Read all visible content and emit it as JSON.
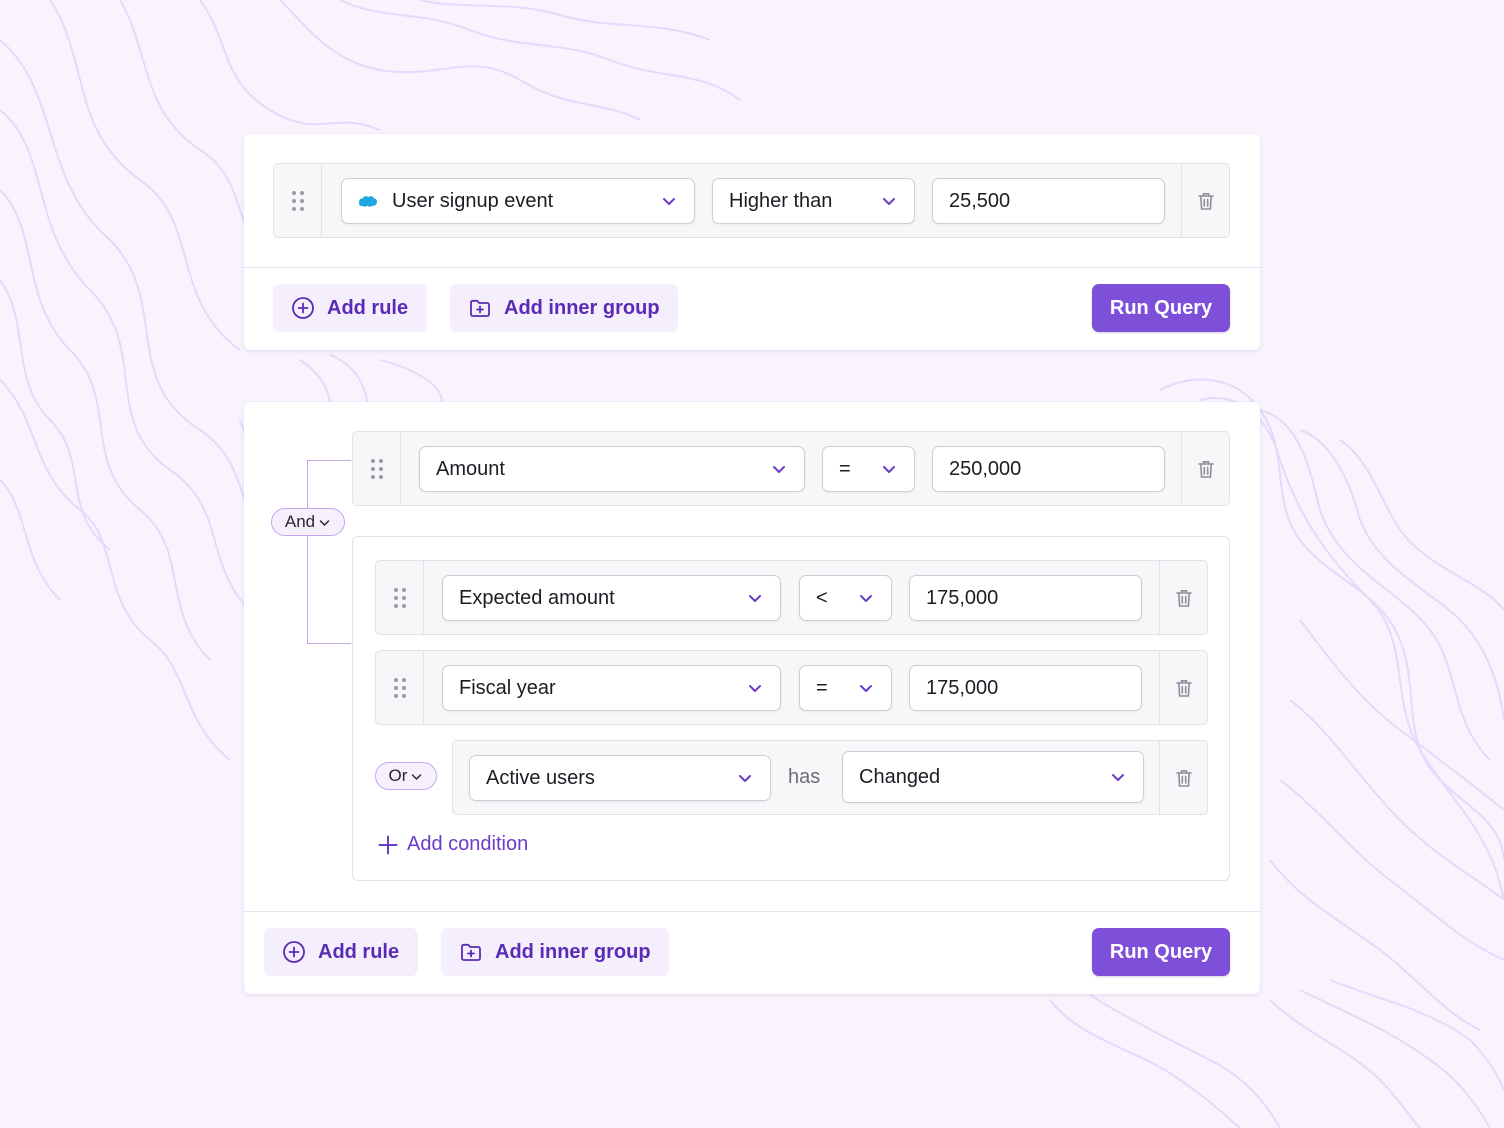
{
  "colors": {
    "background": "#f8f3fd",
    "accent": "#7e4fd9",
    "accent_text": "#5b2bb5",
    "soft_button": "#f5eefc",
    "topo_lines": "#e5d3fb",
    "salesforce_icon": "#1ba7e0"
  },
  "query_a": {
    "rule": {
      "source_icon": "salesforce-cloud-icon",
      "field": "User signup event",
      "operator": "Higher than",
      "value": "25,500"
    },
    "actions": {
      "add_rule": "Add rule",
      "add_inner_group": "Add inner group",
      "run_query": "Run Query"
    }
  },
  "query_b": {
    "combinator": "And",
    "rule": {
      "field": "Amount",
      "operator": "=",
      "value": "250,000"
    },
    "group": {
      "rules": [
        {
          "field": "Expected amount",
          "operator": "<",
          "value": "175,000"
        },
        {
          "field": "Fiscal year",
          "operator": "=",
          "value": "175,000"
        }
      ],
      "or_rule": {
        "combinator": "Or",
        "field": "Active users",
        "verb": "has",
        "value": "Changed"
      },
      "add_condition": "Add condition"
    },
    "actions": {
      "add_rule": "Add rule",
      "add_inner_group": "Add inner group",
      "run_query": "Run Query"
    }
  }
}
